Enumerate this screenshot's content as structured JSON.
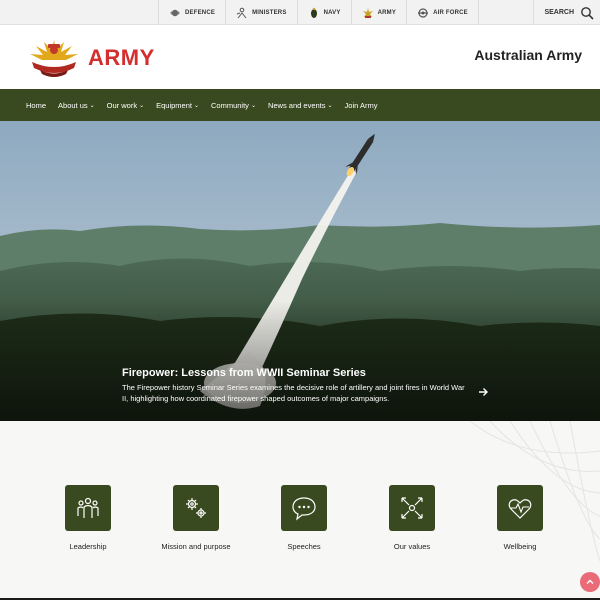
{
  "topbar": {
    "links": [
      {
        "label": "DEFENCE",
        "icon": "defence-crest-icon"
      },
      {
        "label": "MINISTERS",
        "icon": "ministers-icon"
      },
      {
        "label": "NAVY",
        "icon": "navy-crest-icon"
      },
      {
        "label": "ARMY",
        "icon": "army-crest-icon"
      },
      {
        "label": "AIR FORCE",
        "icon": "air-force-crest-icon"
      }
    ],
    "search_label": "SEARCH"
  },
  "header": {
    "logo_word": "ARMY",
    "site_title": "Australian Army"
  },
  "nav": {
    "items": [
      {
        "label": "Home",
        "dropdown": false
      },
      {
        "label": "About us",
        "dropdown": true
      },
      {
        "label": "Our work",
        "dropdown": true
      },
      {
        "label": "Equipment",
        "dropdown": true
      },
      {
        "label": "Community",
        "dropdown": true
      },
      {
        "label": "News and events",
        "dropdown": true
      },
      {
        "label": "Join Army",
        "dropdown": false
      }
    ]
  },
  "hero": {
    "title": "Firepower: Lessons from WWII Seminar Series",
    "description": "The Firepower history Seminar Series examines the decisive role of artillery and joint fires in World War II, highlighting how coordinated firepower shaped outcomes of major campaigns."
  },
  "features": [
    {
      "label": "Leadership",
      "icon": "leadership-icon"
    },
    {
      "label": "Mission and purpose",
      "icon": "gears-icon"
    },
    {
      "label": "Speeches",
      "icon": "speech-bubble-icon"
    },
    {
      "label": "Our values",
      "icon": "values-arrows-icon"
    },
    {
      "label": "Wellbeing",
      "icon": "heart-pulse-icon"
    }
  ],
  "colors": {
    "nav_bg": "#3a4a20",
    "brand_red": "#d32f2f",
    "tile_bg": "#3a4a20",
    "back_to_top": "#e96b78"
  }
}
